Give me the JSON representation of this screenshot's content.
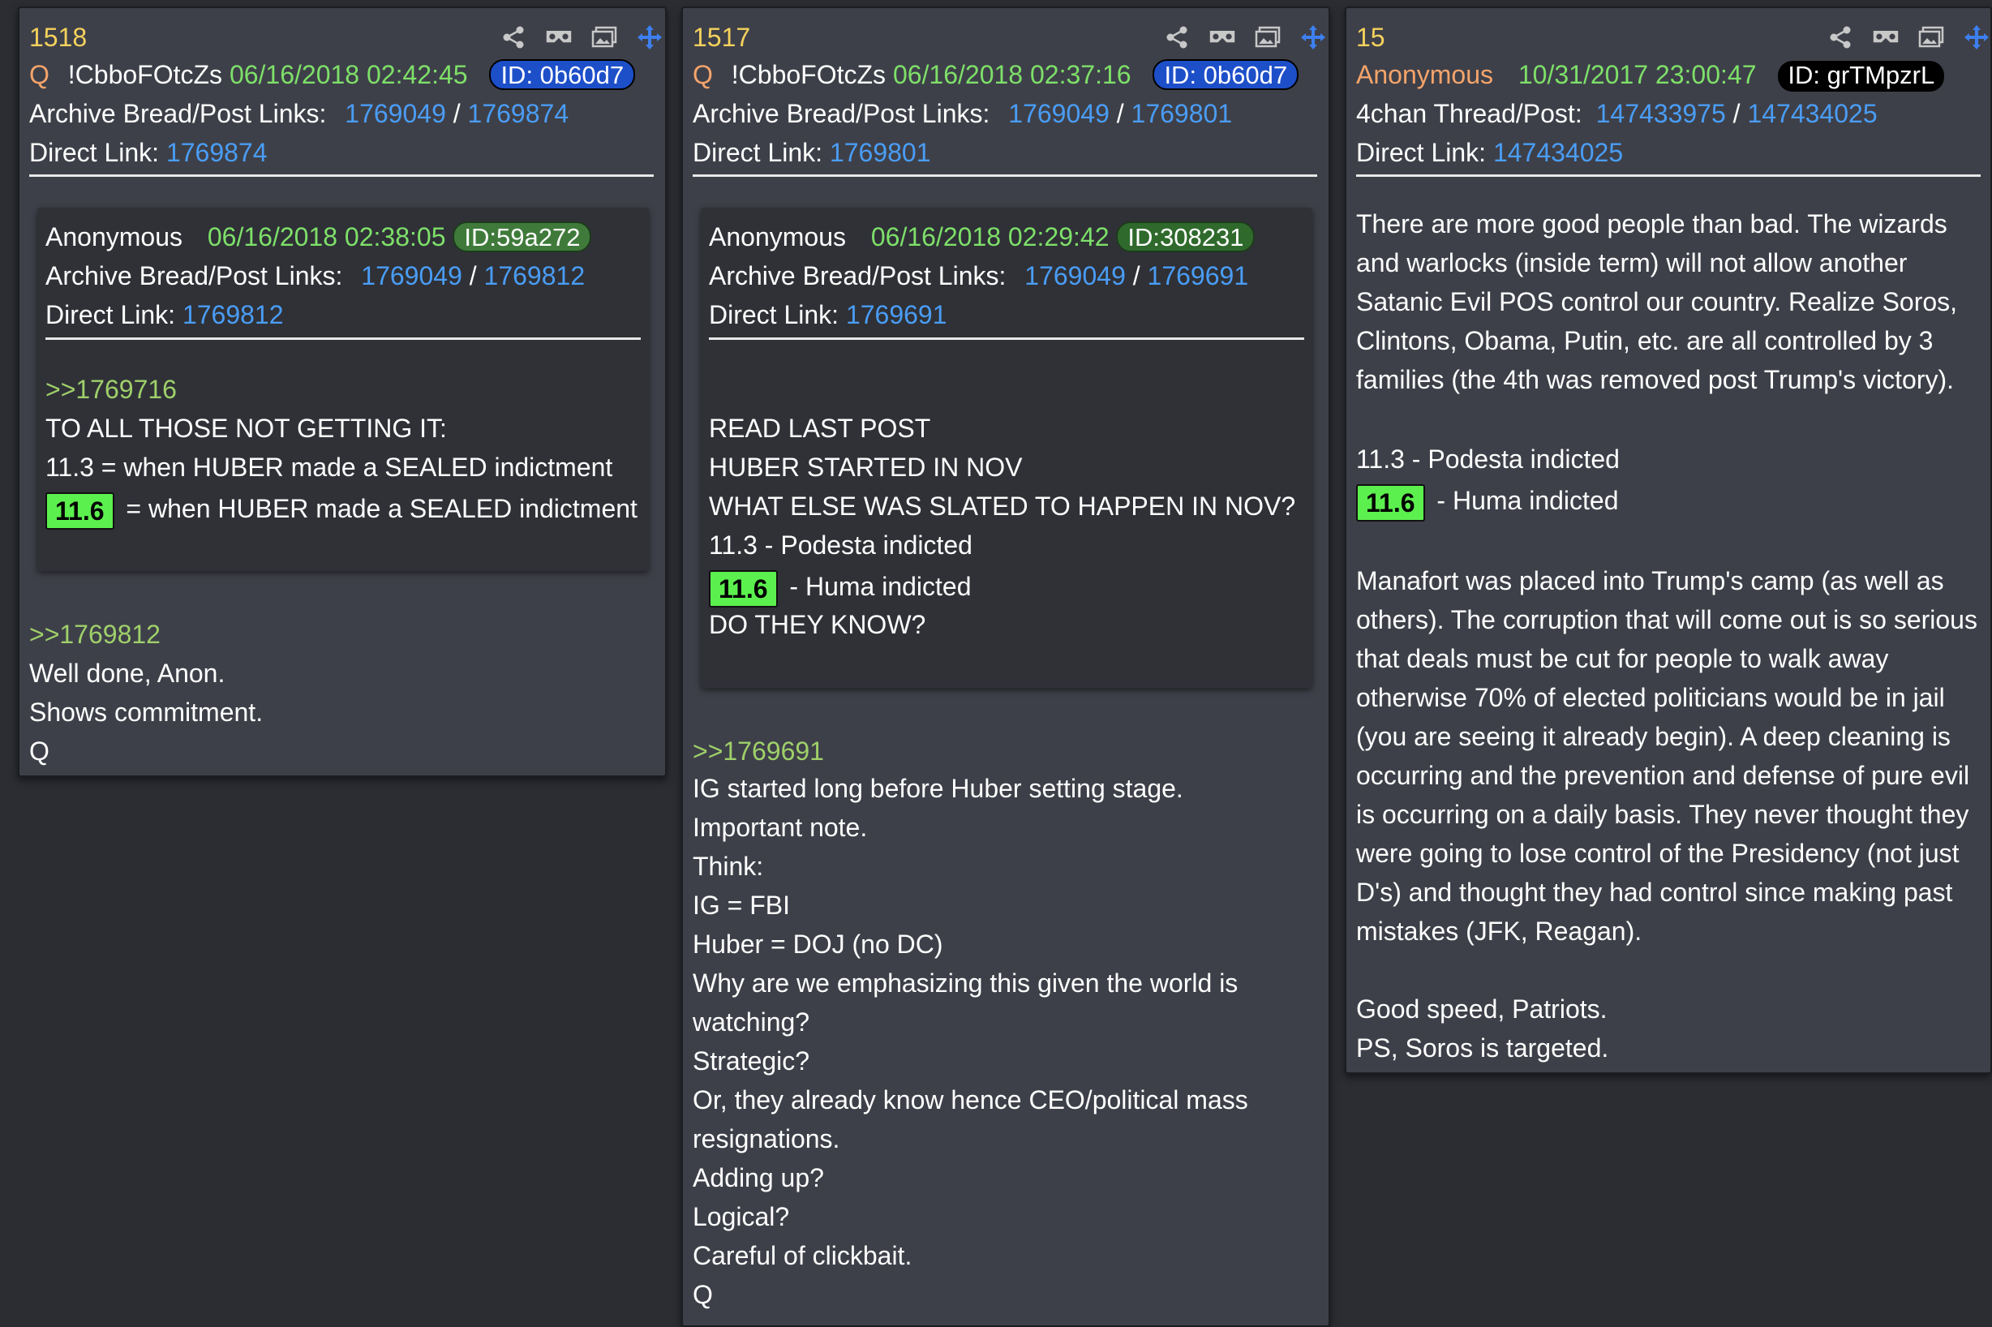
{
  "cards": [
    {
      "number": "1518",
      "author_mark": "Q",
      "tripcode": "!CbboFOtcZs",
      "date": "06/16/2018 02:42:45",
      "id": "ID: 0b60d7",
      "links_label": "Archive Bread/Post Links:",
      "bread_link": "1769049",
      "post_link": "1769874",
      "direct_label": "Direct Link:",
      "direct_link": "1769874",
      "quoted": {
        "author": "Anonymous",
        "date": "06/16/2018 02:38:05",
        "id": "ID:59a272",
        "links_label": "Archive Bread/Post Links:",
        "bread_link": "1769049",
        "post_link": "1769812",
        "direct_label": "Direct Link:",
        "direct_link": "1769812",
        "reply_ref": ">>1769716",
        "lines": [
          "TO ALL THOSE NOT GETTING IT:",
          "11.3 = when HUBER made a SEALED indictment"
        ],
        "highlight": "11.6",
        "highlight_text": "= when HUBER made a SEALED indictment"
      },
      "reply_ref": ">>1769812",
      "lines": [
        "Well done, Anon.",
        "Shows commitment.",
        "Q"
      ]
    },
    {
      "number": "1517",
      "author_mark": "Q",
      "tripcode": "!CbboFOtcZs",
      "date": "06/16/2018 02:37:16",
      "id": "ID: 0b60d7",
      "links_label": "Archive Bread/Post Links:",
      "bread_link": "1769049",
      "post_link": "1769801",
      "direct_label": "Direct Link:",
      "direct_link": "1769801",
      "quoted": {
        "author": "Anonymous",
        "date": "06/16/2018 02:29:42",
        "id": "ID:308231",
        "links_label": "Archive Bread/Post Links:",
        "bread_link": "1769049",
        "post_link": "1769691",
        "direct_label": "Direct Link:",
        "direct_link": "1769691",
        "lines": [
          "READ LAST POST",
          "HUBER STARTED IN NOV",
          "WHAT ELSE WAS SLATED TO HAPPEN IN NOV?",
          "11.3 - Podesta indicted"
        ],
        "highlight": "11.6",
        "highlight_text": "- Huma indicted",
        "after": "DO THEY KNOW?"
      },
      "reply_ref": ">>1769691",
      "lines": [
        "IG started long before Huber setting stage.",
        "Important note.",
        "Think:",
        "IG = FBI",
        "Huber = DOJ (no DC)",
        "Why are we emphasizing this given the world is",
        "watching?",
        "Strategic?",
        "Or, they already know hence CEO/political mass",
        "resignations.",
        "Adding up?",
        "Logical?",
        "Careful of clickbait.",
        "Q"
      ]
    },
    {
      "number": "15",
      "author": "Anonymous",
      "date": "10/31/2017 23:00:47",
      "id": "ID: grTMpzrL",
      "links_label": "4chan Thread/Post:",
      "thread_link": "147433975",
      "post_link": "147434025",
      "direct_label": "Direct Link:",
      "direct_link": "147434025",
      "para1": [
        "There are more good people than bad. The wizards",
        "and warlocks (inside term) will not allow another",
        "Satanic Evil POS control our country. Realize Soros,",
        "Clintons, Obama, Putin, etc. are all controlled by 3",
        "families (the 4th was removed post Trump's victory)."
      ],
      "line_113": "11.3 - Podesta indicted",
      "highlight": "11.6",
      "highlight_text": "- Huma indicted",
      "para2": [
        "Manafort was placed into Trump's camp (as well as",
        "others). The corruption that will come out is so serious",
        "that deals must be cut for people to walk away",
        "otherwise 70% of elected politicians would be in jail",
        "(you are seeing it already begin). A deep cleaning is",
        "occurring and the prevention and defense of pure evil",
        "is occurring on a daily basis. They never thought they",
        "were going to lose control of the Presidency (not just",
        "D's) and thought they had control since making past",
        "mistakes (JFK, Reagan)."
      ],
      "para3": [
        "Good speed, Patriots.",
        "PS, Soros is targeted."
      ]
    }
  ],
  "icons": [
    "share-icon",
    "vr-glasses-icon",
    "image-icon",
    "move-icon"
  ],
  "colors": {
    "background": "#2b2d33",
    "card": "#3e4049",
    "number": "#f5d25c",
    "anon": "#f4a46b",
    "date": "#7ee069",
    "link": "#4a9df5",
    "reply": "#9fd06a",
    "highlight": "#5cf04e"
  }
}
